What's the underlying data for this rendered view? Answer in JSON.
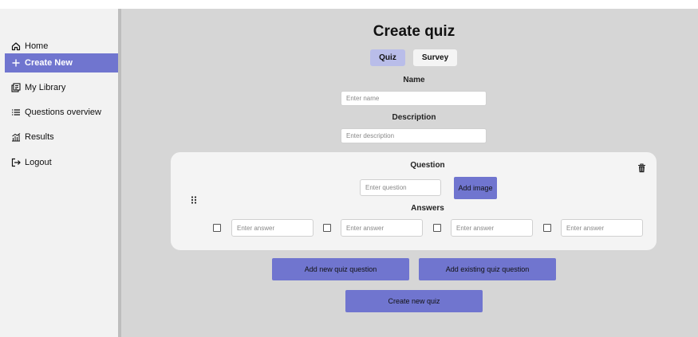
{
  "sidebar": {
    "items": [
      {
        "label": "Home",
        "icon": "home-icon"
      },
      {
        "label": "Create New",
        "icon": "plus-icon",
        "active": true
      },
      {
        "label": "My Library",
        "icon": "library-icon"
      },
      {
        "label": "Questions overview",
        "icon": "list-icon"
      },
      {
        "label": "Results",
        "icon": "chart-icon"
      },
      {
        "label": "Logout",
        "icon": "logout-icon"
      }
    ]
  },
  "main": {
    "title": "Create quiz",
    "tabs": [
      {
        "label": "Quiz",
        "selected": true
      },
      {
        "label": "Survey",
        "selected": false
      }
    ],
    "name_label": "Name",
    "name_placeholder": "Enter name",
    "description_label": "Description",
    "description_placeholder": "Enter description",
    "question_card": {
      "question_label": "Question",
      "question_placeholder": "Enter question",
      "add_image_label": "Add image",
      "answers_label": "Answers",
      "answer_placeholder": "Enter answer",
      "answers": [
        {
          "placeholder": "Enter answer",
          "checked": false
        },
        {
          "placeholder": "Enter answer",
          "checked": false
        },
        {
          "placeholder": "Enter answer",
          "checked": false
        },
        {
          "placeholder": "Enter answer",
          "checked": false
        }
      ]
    },
    "add_new_question_label": "Add new quiz question",
    "add_existing_question_label": "Add existing quiz question",
    "create_quiz_label": "Create new quiz"
  },
  "colors": {
    "accent": "#7075cf",
    "selected_tab": "#b9bde9",
    "background": "#d6d6d6",
    "card": "#f4f4f4"
  }
}
